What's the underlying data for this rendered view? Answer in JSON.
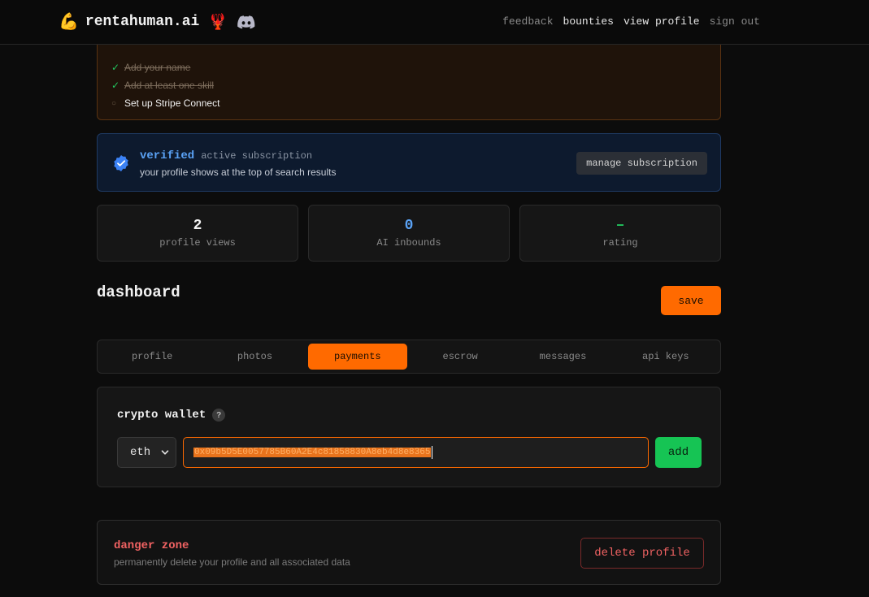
{
  "nav": {
    "brand": "rentahuman.ai",
    "brand_icon": "flexed-arm-icon",
    "links": [
      {
        "label": "feedback",
        "style": "dim"
      },
      {
        "label": "bounties",
        "style": "bright"
      },
      {
        "label": "view profile",
        "style": "bright"
      },
      {
        "label": "sign out",
        "style": "dim"
      }
    ]
  },
  "onboarding": {
    "items": [
      {
        "label": "Add your name",
        "done": true
      },
      {
        "label": "Add at least one skill",
        "done": true
      },
      {
        "label": "Set up Stripe Connect",
        "done": false
      }
    ]
  },
  "verified": {
    "title": "verified",
    "status": "active subscription",
    "description": "your profile shows at the top of search results",
    "button": "manage subscription"
  },
  "stats": [
    {
      "value": "2",
      "label": "profile views",
      "color": "#f2f2f2"
    },
    {
      "value": "0",
      "label": "AI inbounds",
      "color": "#5aa2f5"
    },
    {
      "value": "–",
      "label": "rating",
      "color": "#22c55e"
    }
  ],
  "dashboard": {
    "title": "dashboard",
    "save_label": "save",
    "tabs": [
      {
        "label": "profile",
        "active": false
      },
      {
        "label": "photos",
        "active": false
      },
      {
        "label": "payments",
        "active": true
      },
      {
        "label": "escrow",
        "active": false
      },
      {
        "label": "messages",
        "active": false
      },
      {
        "label": "api keys",
        "active": false
      }
    ]
  },
  "wallet": {
    "title": "crypto wallet",
    "help": "?",
    "chain": "eth",
    "address": "0x09b5D5E0057785B60A2E4c81858830A8eb4d8e8365",
    "add_label": "add"
  },
  "danger": {
    "title": "danger zone",
    "description": "permanently delete your profile and all associated data",
    "button": "delete profile"
  },
  "colors": {
    "accent": "#ff6a00",
    "success": "#16c454",
    "danger": "#f06262",
    "verified": "#5aa2f5"
  }
}
